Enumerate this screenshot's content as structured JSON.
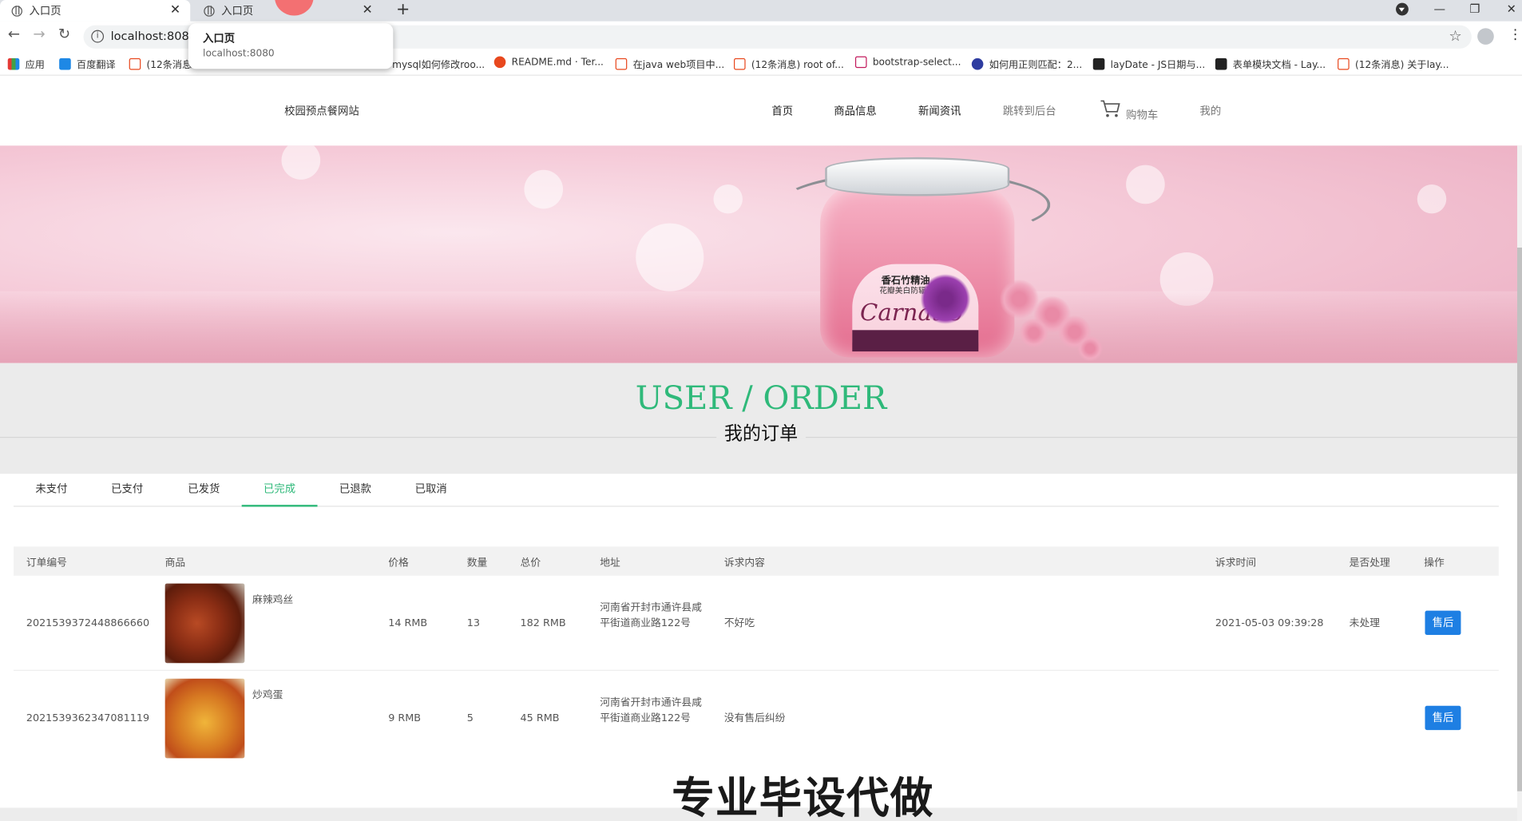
{
  "browser": {
    "tabs": [
      {
        "title": "入口页"
      },
      {
        "title": "入口页"
      }
    ],
    "url": "localhost:8080",
    "tooltip": {
      "title": "入口页",
      "url": "localhost:8080"
    },
    "bookmarks": [
      {
        "label": "应用",
        "icon": "apps-icon"
      },
      {
        "label": "百度翻译",
        "icon": "translate-icon"
      },
      {
        "label": "(12条消息",
        "icon": "csdn-icon"
      },
      {
        "label": "mysql如何修改roo...",
        "icon": "csdn-icon"
      },
      {
        "label": "README.md · Ter...",
        "icon": "gitee-icon"
      },
      {
        "label": "在java web项目中...",
        "icon": "csdn-icon"
      },
      {
        "label": "(12条消息) root of...",
        "icon": "csdn-icon"
      },
      {
        "label": "bootstrap-select...",
        "icon": "bootstrap-icon"
      },
      {
        "label": "如何用正则匹配：2...",
        "icon": "baidu-icon"
      },
      {
        "label": "layDate - JS日期与...",
        "icon": "layui-icon"
      },
      {
        "label": "表单模块文档 - Lay...",
        "icon": "layui-icon"
      },
      {
        "label": "(12条消息) 关于lay...",
        "icon": "csdn-icon"
      }
    ]
  },
  "site": {
    "title": "校园预点餐网站",
    "nav": [
      {
        "label": "首页"
      },
      {
        "label": "商品信息"
      },
      {
        "label": "新闻资讯"
      },
      {
        "label": "跳转到后台"
      },
      {
        "label": "购物车"
      },
      {
        "label": "我的"
      }
    ]
  },
  "banner": {
    "product_name": "香石竹精油",
    "product_subtitle": "花瓣美白防辐面膜",
    "brand": "Carnatio"
  },
  "order": {
    "heading_en": "USER / ORDER",
    "heading_zh": "我的订单",
    "tabs": [
      {
        "label": "未支付"
      },
      {
        "label": "已支付"
      },
      {
        "label": "已发货"
      },
      {
        "label": "已完成",
        "active": true
      },
      {
        "label": "已退款"
      },
      {
        "label": "已取消"
      }
    ],
    "columns": [
      "订单编号",
      "商品",
      "价格",
      "数量",
      "总价",
      "地址",
      "诉求内容",
      "诉求时间",
      "是否处理",
      "操作"
    ],
    "rows": [
      {
        "id": "2021539372448866660",
        "product": "麻辣鸡丝",
        "price": "14 RMB",
        "qty": "13",
        "total": "182 RMB",
        "address": "河南省开封市通许县咸平街道商业路122号",
        "complaint": "不好吃",
        "complaint_time": "2021-05-03 09:39:28",
        "handled": "未处理",
        "action": "售后"
      },
      {
        "id": "2021539362347081119",
        "product": "炒鸡蛋",
        "price": "9 RMB",
        "qty": "5",
        "total": "45 RMB",
        "address": "河南省开封市通许县咸平街道商业路122号",
        "complaint": "没有售后纠纷",
        "complaint_time": "",
        "handled": "",
        "action": "售后"
      }
    ]
  },
  "watermark": "专业毕设代做",
  "colors": {
    "accent": "#2fb97a",
    "button": "#1e7fe3"
  }
}
